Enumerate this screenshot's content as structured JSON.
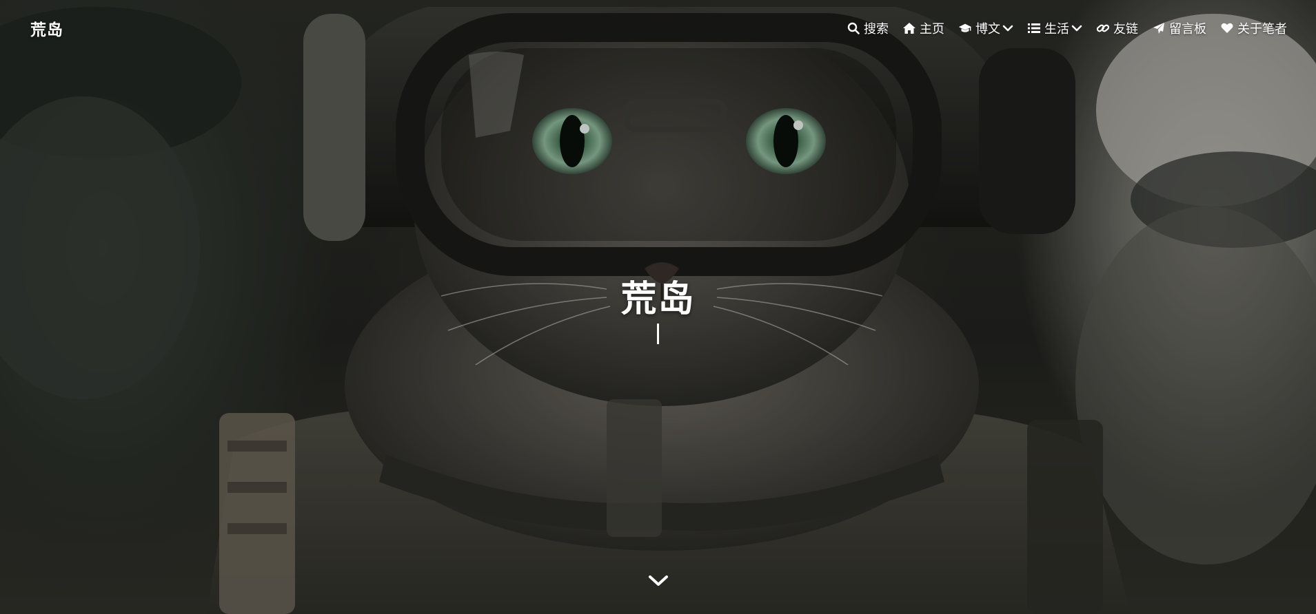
{
  "brand": "荒岛",
  "nav": [
    {
      "label": "搜索",
      "icon": "search-icon",
      "dropdown": false
    },
    {
      "label": "主页",
      "icon": "home-icon",
      "dropdown": false
    },
    {
      "label": "博文",
      "icon": "graduation-cap-icon",
      "dropdown": true
    },
    {
      "label": "生活",
      "icon": "list-icon",
      "dropdown": true
    },
    {
      "label": "友链",
      "icon": "link-icon",
      "dropdown": false
    },
    {
      "label": "留言板",
      "icon": "paper-plane-icon",
      "dropdown": false
    },
    {
      "label": "关于笔者",
      "icon": "heart-icon",
      "dropdown": false
    }
  ],
  "hero": {
    "title": "荒岛",
    "scroll_icon": "chevron-down-icon"
  },
  "colors": {
    "text": "#ffffff",
    "background": "#22231f"
  }
}
